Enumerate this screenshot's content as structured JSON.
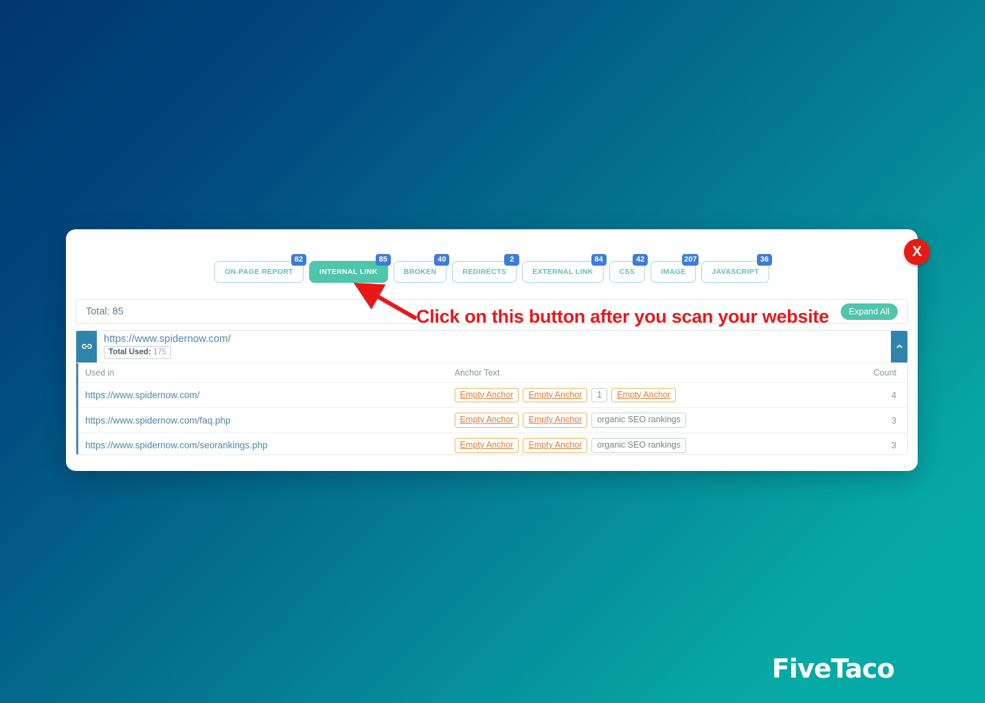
{
  "background": {
    "from": "#00376d",
    "to": "#04aba6"
  },
  "logo": {
    "text": "FiveTaco"
  },
  "modal": {
    "close_label": "X",
    "tabs": [
      {
        "label": "ON-PAGE REPORT",
        "badge": "82",
        "active": false
      },
      {
        "label": "INTERNAL LINK",
        "badge": "85",
        "active": true
      },
      {
        "label": "BROKEN",
        "badge": "40",
        "active": false
      },
      {
        "label": "REDIRECTS",
        "badge": "2",
        "active": false
      },
      {
        "label": "EXTERNAL LINK",
        "badge": "84",
        "active": false
      },
      {
        "label": "CSS",
        "badge": "42",
        "active": false
      },
      {
        "label": "IMAGE",
        "badge": "207",
        "active": false
      },
      {
        "label": "JAVASCRIPT",
        "badge": "36",
        "active": false
      }
    ],
    "total_bar": {
      "total_text": "Total: 85",
      "expand_all_label": "Expand All"
    },
    "result": {
      "url": "https://www.spidernow.com/",
      "total_used_label": "Total Used:",
      "total_used_value": "175",
      "columns": [
        "Used in",
        "Anchor Text",
        "Count"
      ],
      "rows": [
        {
          "used_in": "https://www.spidernow.com/",
          "anchors": [
            {
              "text": "Empty Anchor",
              "type": "empty"
            },
            {
              "text": "Empty Anchor",
              "type": "empty"
            },
            {
              "text": "1",
              "type": "neutral"
            },
            {
              "text": "Empty Anchor",
              "type": "empty"
            }
          ],
          "count": "4"
        },
        {
          "used_in": "https://www.spidernow.com/faq.php",
          "anchors": [
            {
              "text": "Empty Anchor",
              "type": "empty"
            },
            {
              "text": "Empty Anchor",
              "type": "empty"
            },
            {
              "text": "organic SEO rankings",
              "type": "neutral"
            }
          ],
          "count": "3"
        },
        {
          "used_in": "https://www.spidernow.com/seorankings.php",
          "anchors": [
            {
              "text": "Empty Anchor",
              "type": "empty"
            },
            {
              "text": "Empty Anchor",
              "type": "empty"
            },
            {
              "text": "organic SEO rankings",
              "type": "neutral"
            }
          ],
          "count": "3"
        }
      ]
    }
  },
  "annotation": {
    "text": "Click on this button after you scan your website",
    "color": "#e8181a"
  }
}
